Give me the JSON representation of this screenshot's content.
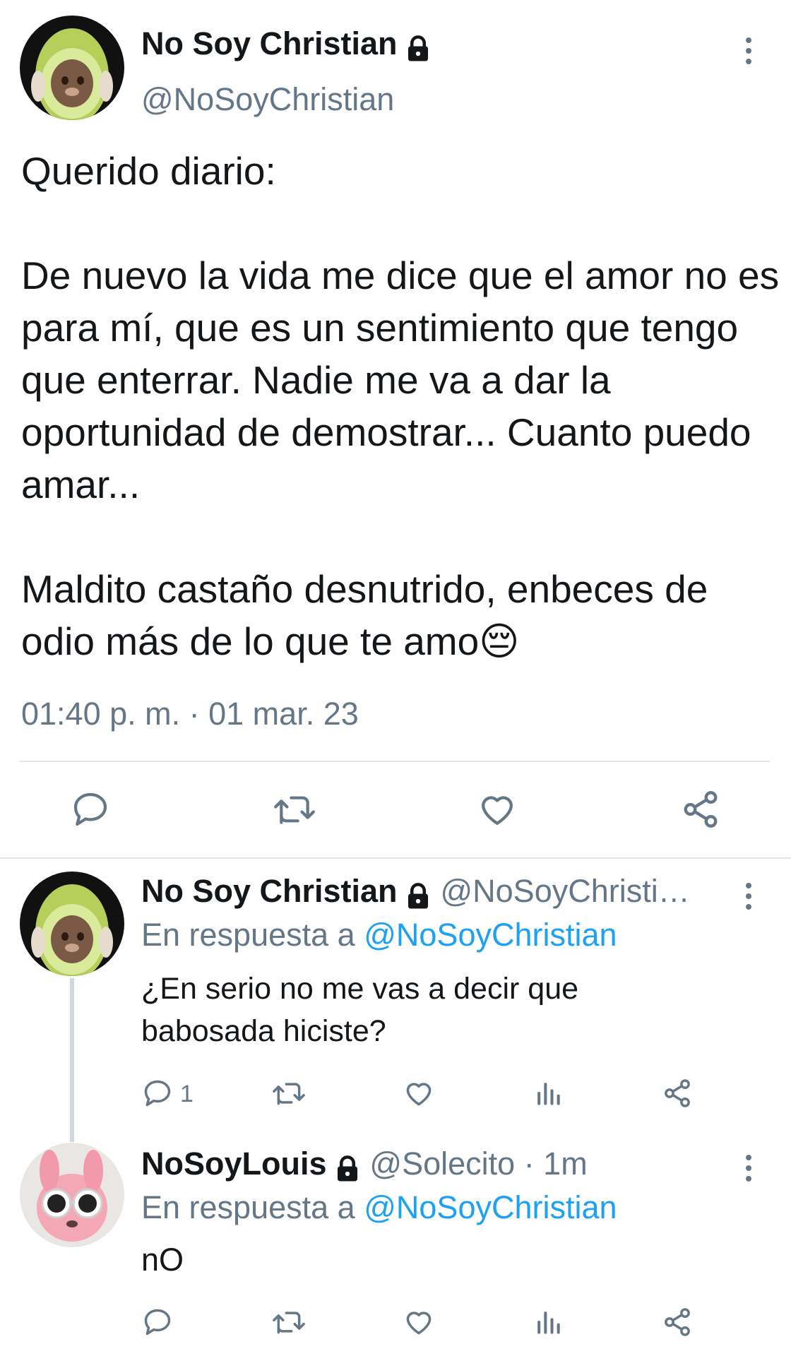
{
  "main_tweet": {
    "display_name": "No Soy Christian",
    "handle": "@NoSoyChristian",
    "paragraphs": [
      "Querido diario:",
      "De nuevo la vida me dice que el amor no es para mí, que es un sentimiento que tengo que enterrar. Nadie me va a dar la oportunidad de demostrar... Cuanto puedo amar...",
      "Maldito castaño desnutrido, enbeces de odio más de lo que te amo😔"
    ],
    "timestamp": "01:40 p. m. · 01 mar. 23",
    "actions": [
      "reply-icon",
      "retweet-icon",
      "like-icon",
      "share-icon"
    ]
  },
  "replies": [
    {
      "display_name": "No Soy Christian",
      "handle": "@NoSoyChristi…",
      "reply_prefix": "En respuesta a",
      "reply_to": "@NoSoyChristian",
      "text_lines": [
        "¿En serio no me vas a decir que",
        "babosada hiciste?"
      ],
      "reply_count": "1"
    },
    {
      "display_name": "NoSoyLouis",
      "handle": "@Solecito · 1m",
      "reply_prefix": "En respuesta a",
      "reply_to": "@NoSoyChristian",
      "text_lines": [
        "nO"
      ],
      "reply_count": ""
    }
  ],
  "colors": {
    "text": "#14171a",
    "secondary": "#657786",
    "link": "#1da1f2",
    "divider": "#e1e8ed"
  }
}
